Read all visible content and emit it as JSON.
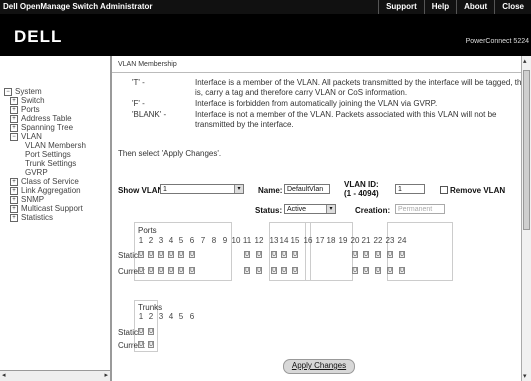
{
  "app_title": "Dell OpenManage Switch Administrator",
  "topnav": [
    "Support",
    "Help",
    "About",
    "Close"
  ],
  "brand": {
    "logo": "DELL",
    "product": "PowerConnect 5224"
  },
  "sidebar": {
    "items": [
      {
        "label": "System",
        "expander": "−"
      },
      {
        "label": "Switch",
        "expander": "+"
      },
      {
        "label": "Ports",
        "expander": "+"
      },
      {
        "label": "Address Table",
        "expander": "+"
      },
      {
        "label": "Spanning Tree",
        "expander": "+"
      },
      {
        "label": "VLAN",
        "expander": "−"
      },
      {
        "label": "VLAN Membersh",
        "expander": ""
      },
      {
        "label": "Port Settings",
        "expander": ""
      },
      {
        "label": "Trunk Settings",
        "expander": ""
      },
      {
        "label": "GVRP",
        "expander": ""
      },
      {
        "label": "Class of Service",
        "expander": "+"
      },
      {
        "label": "Link Aggregation",
        "expander": "+"
      },
      {
        "label": "SNMP",
        "expander": "+"
      },
      {
        "label": "Multicast Support",
        "expander": "+"
      },
      {
        "label": "Statistics",
        "expander": "+"
      }
    ]
  },
  "main": {
    "breadcrumb": "VLAN Membership",
    "legend": [
      {
        "key": "'T' -",
        "text": "Interface is a member of the VLAN. All packets transmitted by the interface will be tagged, that is, carry a tag and therefore carry VLAN or CoS information."
      },
      {
        "key": "'F' -",
        "text": "Interface is forbidden from automatically joining the VLAN via GVRP."
      },
      {
        "key": "'BLANK' -",
        "text": "Interface is not a member of the VLAN. Packets associated with this VLAN will not be transmitted by the interface."
      }
    ],
    "instruction": "Then select 'Apply Changes'.",
    "form": {
      "show_vlan_label": "Show VLAN:",
      "show_vlan_value": "1",
      "name_label": "Name:",
      "name_value": "DefaultVlan",
      "vlan_id_label": "VLAN ID:",
      "vlan_id_range": "(1 - 4094)",
      "vlan_id_value": "1",
      "remove_vlan_label": "Remove VLAN",
      "status_label": "Status:",
      "status_value": "Active",
      "creation_label": "Creation:",
      "creation_value": "Permanent"
    },
    "ports": {
      "header": "Ports",
      "numbers": [
        "1",
        "2",
        "3",
        "4",
        "5",
        "6",
        "7",
        "8",
        "9",
        "10",
        "11",
        "12",
        "13",
        "14",
        "15",
        "16",
        "17",
        "18",
        "19",
        "20",
        "21",
        "22",
        "23",
        "24"
      ],
      "row_labels": [
        "Static",
        "Current"
      ],
      "cell_value": "U",
      "cells_present": [
        1,
        2,
        3,
        4,
        5,
        6,
        11,
        12,
        13,
        14,
        15,
        20,
        21,
        22,
        23,
        24
      ]
    },
    "trunks": {
      "header": "Trunks",
      "numbers": [
        "1",
        "2",
        "3",
        "4",
        "5",
        "6"
      ],
      "row_labels": [
        "Static",
        "Current"
      ],
      "cell_value": "U",
      "cells_present": [
        1,
        2
      ]
    },
    "apply_label": "Apply Changes"
  }
}
